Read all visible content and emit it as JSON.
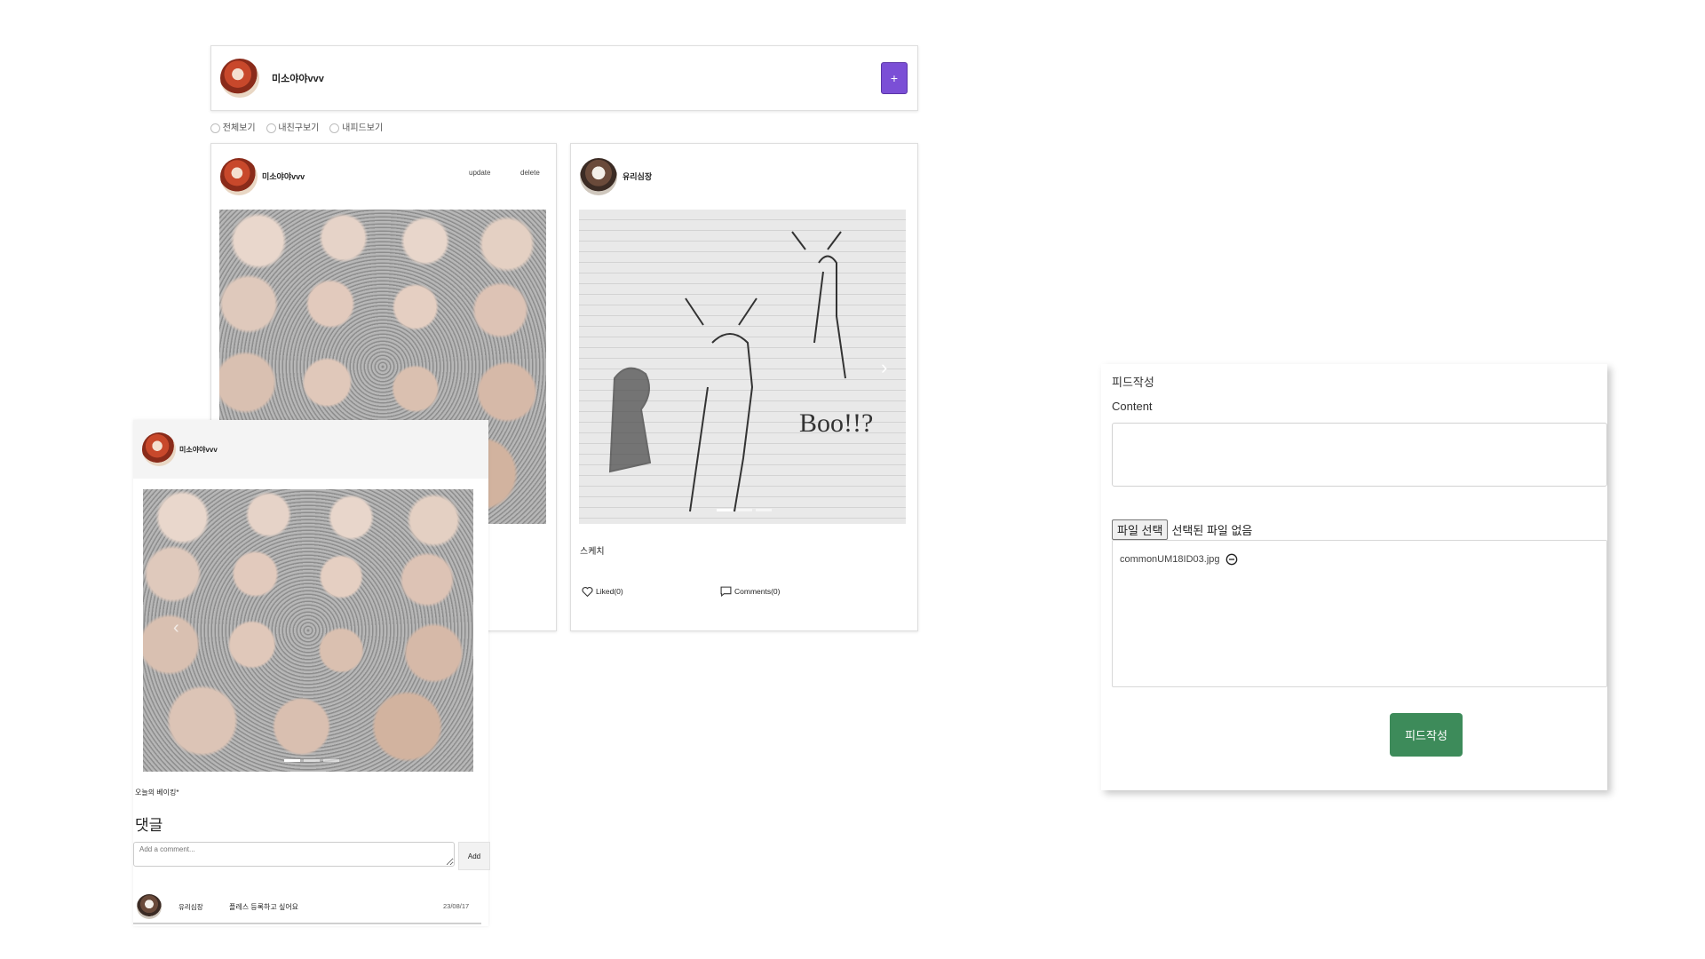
{
  "header_card": {
    "username": "미소야야vvv",
    "add_label": "+"
  },
  "filters": [
    {
      "label": "전체보기"
    },
    {
      "label": "내친구보기"
    },
    {
      "label": "내피드보기"
    }
  ],
  "feed_cards": [
    {
      "username": "미소야야vvv",
      "update_label": "update",
      "delete_label": "delete"
    },
    {
      "username": "유리심장",
      "content": "스케치",
      "liked_label": "Liked(0)",
      "comments_label": "Comments(0)",
      "sketch_text": "Boo!!?"
    }
  ],
  "detail_modal": {
    "username": "미소야야vvv",
    "content": "오늘의 베이킹*",
    "comment_heading": "댓글",
    "comment_placeholder": "Add a comment...",
    "add_label": "Add",
    "comment": {
      "author": "유리심장",
      "text": "플레스 등록하고 싶어요",
      "date": "23/08/17"
    }
  },
  "write_panel": {
    "title": "피드작성",
    "content_label": "Content",
    "file_button": "파일 선택",
    "file_status": "선택된 파일 없음",
    "attached_file": "commonUM18ID03.jpg",
    "submit_label": "피드작성"
  },
  "colors": {
    "accent_purple": "#7b4fd6",
    "submit_green": "#3d8b5a"
  },
  "icons": [
    "plus-icon",
    "heart-icon",
    "comment-icon",
    "remove-circle-icon",
    "chevron-left-icon",
    "chevron-right-icon"
  ]
}
